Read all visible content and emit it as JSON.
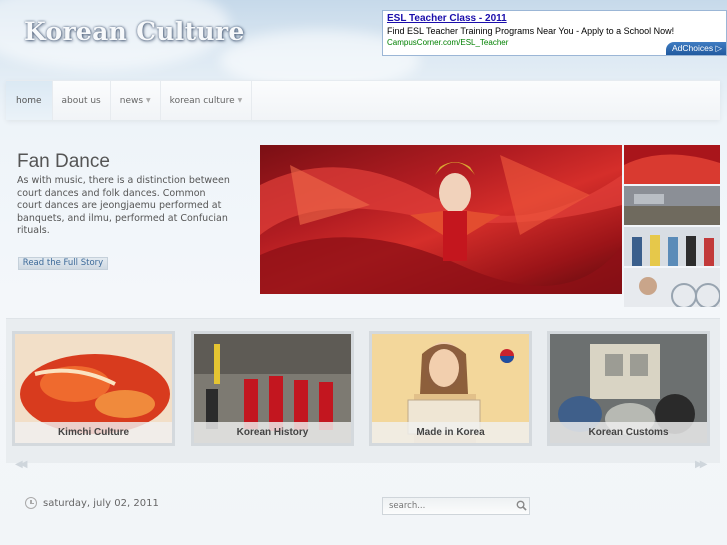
{
  "site": {
    "title": "Korean Culture"
  },
  "ad": {
    "title": "ESL Teacher Class - 2011",
    "text": "Find ESL Teacher Training Programs Near You - Apply to a School Now!",
    "url": "CampusCorner.com/ESL_Teacher",
    "choices_label": "AdChoices ▷"
  },
  "nav": {
    "items": [
      {
        "label": "home",
        "active": true,
        "dropdown": false
      },
      {
        "label": "about us",
        "active": false,
        "dropdown": false
      },
      {
        "label": "news",
        "active": false,
        "dropdown": true
      },
      {
        "label": "korean culture",
        "active": false,
        "dropdown": true
      }
    ]
  },
  "feature": {
    "title": "Fan Dance",
    "text": "As with music, there is a distinction between court dances and folk dances. Common court dances are jeongjaemu performed at banquets, and ilmu, performed at Confucian rituals.",
    "read_more": "Read the Full Story"
  },
  "carousel": {
    "cards": [
      {
        "label": "Kimchi Culture"
      },
      {
        "label": "Korean History"
      },
      {
        "label": "Made in Korea"
      },
      {
        "label": "Korean Customs"
      }
    ],
    "prev_icon": "◀◀",
    "next_icon": "▶▶"
  },
  "footer": {
    "date": "saturday, july 02, 2011",
    "search_placeholder": "search..."
  },
  "colors": {
    "accent": "#3d6a99",
    "ad_link": "#1a0dab",
    "ad_url": "#008000",
    "nav_active": "#dbe9f4"
  }
}
